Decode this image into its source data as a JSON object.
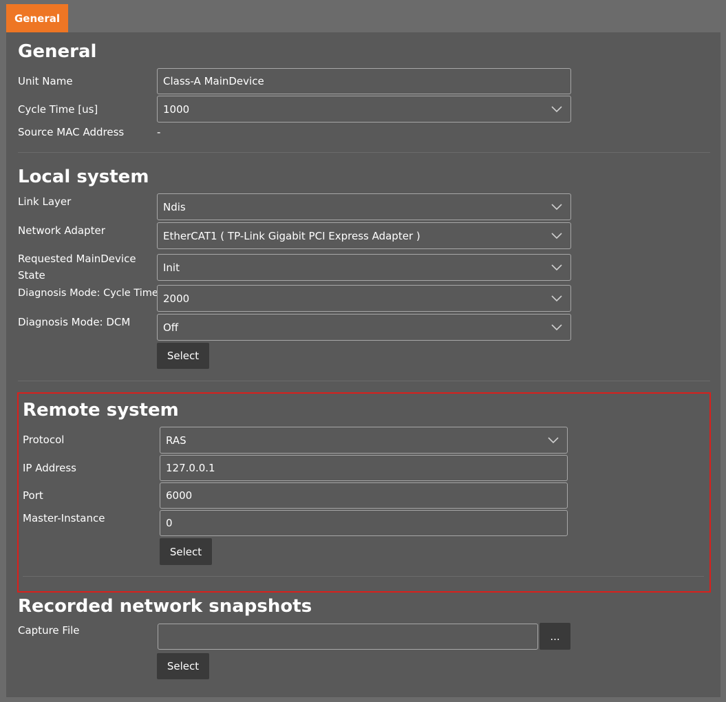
{
  "tabs": [
    {
      "label": "General",
      "active": true
    }
  ],
  "general": {
    "heading": "General",
    "unit_name": {
      "label": "Unit Name",
      "value": "Class-A MainDevice"
    },
    "cycle_time": {
      "label": "Cycle Time [us]",
      "value": "1000"
    },
    "source_mac": {
      "label": "Source MAC Address",
      "value": "-"
    }
  },
  "local": {
    "heading": "Local system",
    "link_layer": {
      "label": "Link Layer",
      "value": "Ndis"
    },
    "network_adapter": {
      "label": "Network Adapter",
      "value": "EtherCAT1 ( TP-Link Gigabit PCI Express Adapter )"
    },
    "requested_state": {
      "label_line1": "Requested MainDevice",
      "label_line2": "State",
      "value": "Init"
    },
    "diag_cycle_time": {
      "label": "Diagnosis Mode: Cycle Time",
      "value": "2000"
    },
    "diag_dcm": {
      "label": "Diagnosis Mode: DCM",
      "value": "Off"
    },
    "select_label": "Select"
  },
  "remote": {
    "heading": "Remote system",
    "protocol": {
      "label": "Protocol",
      "value": "RAS"
    },
    "ip_address": {
      "label": "IP Address",
      "value": "127.0.0.1"
    },
    "port": {
      "label": "Port",
      "value": "6000"
    },
    "master_instance": {
      "label": "Master-Instance",
      "value": "0"
    },
    "select_label": "Select"
  },
  "recorded": {
    "heading": "Recorded network snapshots",
    "capture_file": {
      "label": "Capture File",
      "value": ""
    },
    "browse_label": "...",
    "select_label": "Select"
  },
  "colors": {
    "tab_accent": "#ee7624",
    "highlight_border": "#d9201c",
    "panel_bg": "#595959",
    "page_bg": "#6b6b6b",
    "button_bg": "#3a3a3a"
  },
  "icons": {
    "dropdown": "chevron-down-icon"
  }
}
